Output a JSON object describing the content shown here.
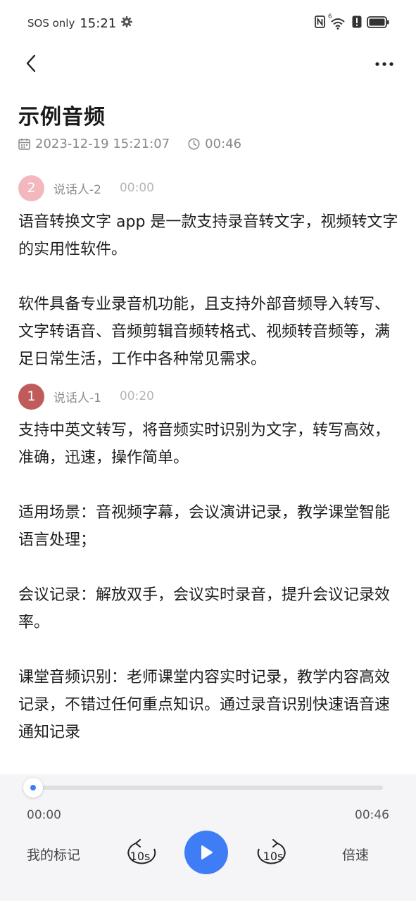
{
  "status_bar": {
    "carrier": "SOS only",
    "time": "15:21",
    "icons": [
      "gear-icon",
      "nfc-icon",
      "wifi-icon",
      "alert-icon",
      "battery-icon"
    ],
    "wifi_badge": "6"
  },
  "nav": {
    "back_icon": "chevron-left-icon",
    "more_icon": "more-dots-icon"
  },
  "recording": {
    "title": "示例音频",
    "datetime": "2023-12-19 15:21:07",
    "duration": "00:46"
  },
  "segments": [
    {
      "speaker_number": "2",
      "speaker_name": "说话人-2",
      "timestamp": "00:00",
      "avatar_color": "#f2b8be",
      "paragraphs": [
        "语音转换文字 app 是一款支持录音转文字，视频转文字的实用性软件。",
        "软件具备专业录音机功能，且支持外部音频导入转写、文字转语音、音频剪辑音频转格式、视频转音频等，满足日常生活，工作中各种常见需求。"
      ]
    },
    {
      "speaker_number": "1",
      "speaker_name": "说话人-1",
      "timestamp": "00:20",
      "avatar_color": "#c05b5b",
      "paragraphs": [
        "支持中英文转写，将音频实时识别为文字，转写高效，准确，迅速，操作简单。",
        "适用场景：音视频字幕，会议演讲记录，教学课堂智能语言处理；",
        "会议记录：解放双手，会议实时录音，提升会议记录效率。",
        "课堂音频识别：老师课堂内容实时记录，教学内容高效记录，不错过任何重点知识。通过录音识别快速语音速通知记录"
      ]
    }
  ],
  "player": {
    "current_time": "00:00",
    "total_time": "00:46",
    "progress": 0,
    "mark_label": "我的标记",
    "rewind_label": "10s",
    "forward_label": "10s",
    "speed_label": "倍速",
    "accent_color": "#3f7df6"
  }
}
